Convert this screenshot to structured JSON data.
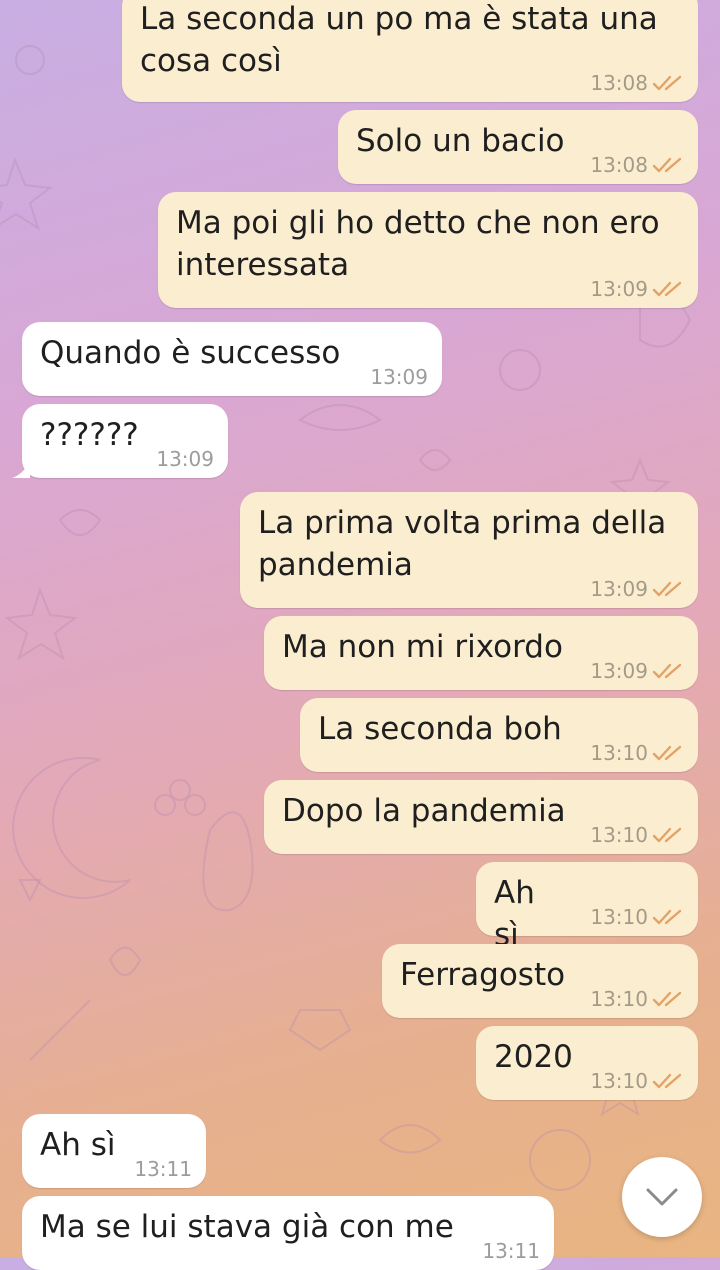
{
  "messages": [
    {
      "dir": "out",
      "text": "La seconda un po ma è stata una cosa così",
      "time": "13:08"
    },
    {
      "dir": "out",
      "text": "Solo un bacio",
      "time": "13:08"
    },
    {
      "dir": "out",
      "text": "Ma poi gli ho detto che non ero interessata",
      "time": "13:09"
    },
    {
      "dir": "in",
      "text": "Quando è successo",
      "time": "13:09"
    },
    {
      "dir": "in",
      "text": "??????",
      "time": "13:09"
    },
    {
      "dir": "out",
      "text": "La prima volta prima della pandemia",
      "time": "13:09"
    },
    {
      "dir": "out",
      "text": "Ma non mi rixordo",
      "time": "13:09"
    },
    {
      "dir": "out",
      "text": "La seconda boh",
      "time": "13:10"
    },
    {
      "dir": "out",
      "text": "Dopo la pandemia",
      "time": "13:10"
    },
    {
      "dir": "out",
      "text": "Ah sì",
      "time": "13:10"
    },
    {
      "dir": "out",
      "text": "Ferragosto",
      "time": "13:10"
    },
    {
      "dir": "out",
      "text": "2020",
      "time": "13:10"
    },
    {
      "dir": "in",
      "text": "Ah sì",
      "time": "13:11"
    },
    {
      "dir": "in",
      "text": "Ma se lui stava già con me",
      "time": "13:11"
    }
  ],
  "icons": {
    "read_receipt": "double-check-icon",
    "scroll_down": "chevron-down-icon"
  },
  "colors": {
    "outgoing_bubble": "#fbeed0",
    "incoming_bubble": "#ffffff",
    "check_color": "#e3a266"
  }
}
